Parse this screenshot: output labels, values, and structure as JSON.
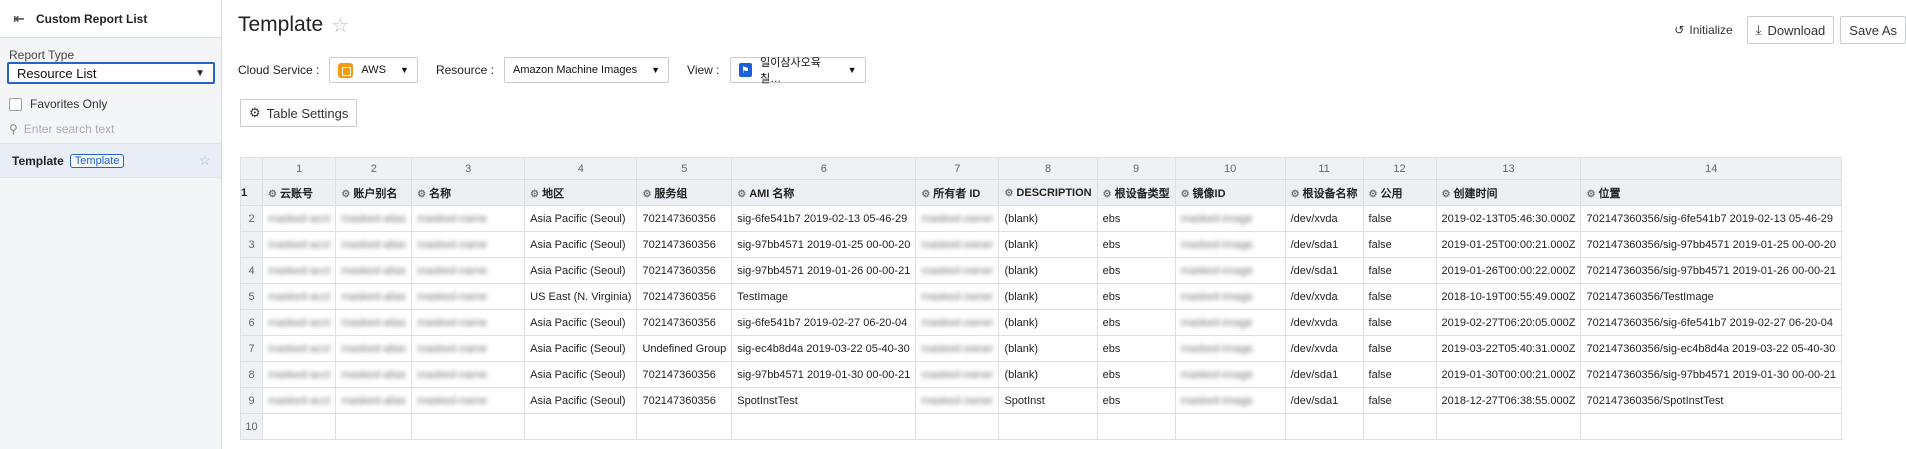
{
  "sidebar": {
    "title": "Custom Report List",
    "report_type_label": "Report Type",
    "report_type_value": "Resource List",
    "favorites_label": "Favorites Only",
    "search_placeholder": "Enter search text",
    "item": {
      "name": "Template",
      "tag": "Template"
    }
  },
  "header": {
    "title": "Template",
    "actions": {
      "initialize": "Initialize",
      "download": "Download",
      "save_as": "Save As"
    }
  },
  "filters": {
    "cloud_service_label": "Cloud Service :",
    "cloud_service_value": "AWS",
    "resource_label": "Resource :",
    "resource_value": "Amazon Machine Images",
    "view_label": "View :",
    "view_value": "일이삼사오육칠…"
  },
  "table_settings_label": "Table Settings",
  "grid": {
    "column_numbers": [
      "1",
      "2",
      "3",
      "4",
      "5",
      "6",
      "7",
      "8",
      "9",
      "10",
      "11",
      "12",
      "13",
      "14"
    ],
    "headers": [
      "云账号",
      "账户别名",
      "名称",
      "地区",
      "服务组",
      "AMI 名称",
      "所有者 ID",
      "DESCRIPTION",
      "根设备类型",
      "镜像ID",
      "根设备名称",
      "公用",
      "创建时间",
      "位置"
    ],
    "rows": [
      {
        "n": "2",
        "c": [
          "masked-acct",
          "masked-alias",
          "masked-name",
          "Asia Pacific (Seoul)",
          "702147360356",
          "sig-6fe541b7 2019-02-13 05-46-29",
          "masked-owner",
          "(blank)",
          "ebs",
          "masked-image",
          "/dev/xvda",
          "false",
          "2019-02-13T05:46:30.000Z",
          "702147360356/sig-6fe541b7 2019-02-13 05-46-29"
        ]
      },
      {
        "n": "3",
        "c": [
          "masked-acct",
          "masked-alias",
          "masked-name",
          "Asia Pacific (Seoul)",
          "702147360356",
          "sig-97bb4571 2019-01-25 00-00-20",
          "masked-owner",
          "(blank)",
          "ebs",
          "masked-image",
          "/dev/sda1",
          "false",
          "2019-01-25T00:00:21.000Z",
          "702147360356/sig-97bb4571 2019-01-25 00-00-20"
        ]
      },
      {
        "n": "4",
        "c": [
          "masked-acct",
          "masked-alias",
          "masked-name",
          "Asia Pacific (Seoul)",
          "702147360356",
          "sig-97bb4571 2019-01-26 00-00-21",
          "masked-owner",
          "(blank)",
          "ebs",
          "masked-image",
          "/dev/sda1",
          "false",
          "2019-01-26T00:00:22.000Z",
          "702147360356/sig-97bb4571 2019-01-26 00-00-21"
        ]
      },
      {
        "n": "5",
        "c": [
          "masked-acct",
          "masked-alias",
          "masked-name",
          "US East (N. Virginia)",
          "702147360356",
          "TestImage",
          "masked-owner",
          "(blank)",
          "ebs",
          "masked-image",
          "/dev/xvda",
          "false",
          "2018-10-19T00:55:49.000Z",
          "702147360356/TestImage"
        ]
      },
      {
        "n": "6",
        "c": [
          "masked-acct",
          "masked-alias",
          "masked-name",
          "Asia Pacific (Seoul)",
          "702147360356",
          "sig-6fe541b7 2019-02-27 06-20-04",
          "masked-owner",
          "(blank)",
          "ebs",
          "masked-image",
          "/dev/xvda",
          "false",
          "2019-02-27T06:20:05.000Z",
          "702147360356/sig-6fe541b7 2019-02-27 06-20-04"
        ]
      },
      {
        "n": "7",
        "c": [
          "masked-acct",
          "masked-alias",
          "masked-name",
          "Asia Pacific (Seoul)",
          "Undefined Group",
          "sig-ec4b8d4a 2019-03-22 05-40-30",
          "masked-owner",
          "(blank)",
          "ebs",
          "masked-image",
          "/dev/xvda",
          "false",
          "2019-03-22T05:40:31.000Z",
          "702147360356/sig-ec4b8d4a 2019-03-22 05-40-30"
        ]
      },
      {
        "n": "8",
        "c": [
          "masked-acct",
          "masked-alias",
          "masked-name",
          "Asia Pacific (Seoul)",
          "702147360356",
          "sig-97bb4571 2019-01-30 00-00-21",
          "masked-owner",
          "(blank)",
          "ebs",
          "masked-image",
          "/dev/sda1",
          "false",
          "2019-01-30T00:00:21.000Z",
          "702147360356/sig-97bb4571 2019-01-30 00-00-21"
        ]
      },
      {
        "n": "9",
        "c": [
          "masked-acct",
          "masked-alias",
          "masked-name",
          "Asia Pacific (Seoul)",
          "702147360356",
          "SpotInstTest",
          "masked-owner",
          "SpotInst",
          "ebs",
          "masked-image",
          "/dev/sda1",
          "false",
          "2018-12-27T06:38:55.000Z",
          "702147360356/SpotInstTest"
        ]
      },
      {
        "n": "10",
        "c": [
          "",
          "",
          "",
          "",
          "",
          "",
          "",
          "",
          "",
          "",
          "",
          "",
          "",
          ""
        ]
      }
    ]
  }
}
